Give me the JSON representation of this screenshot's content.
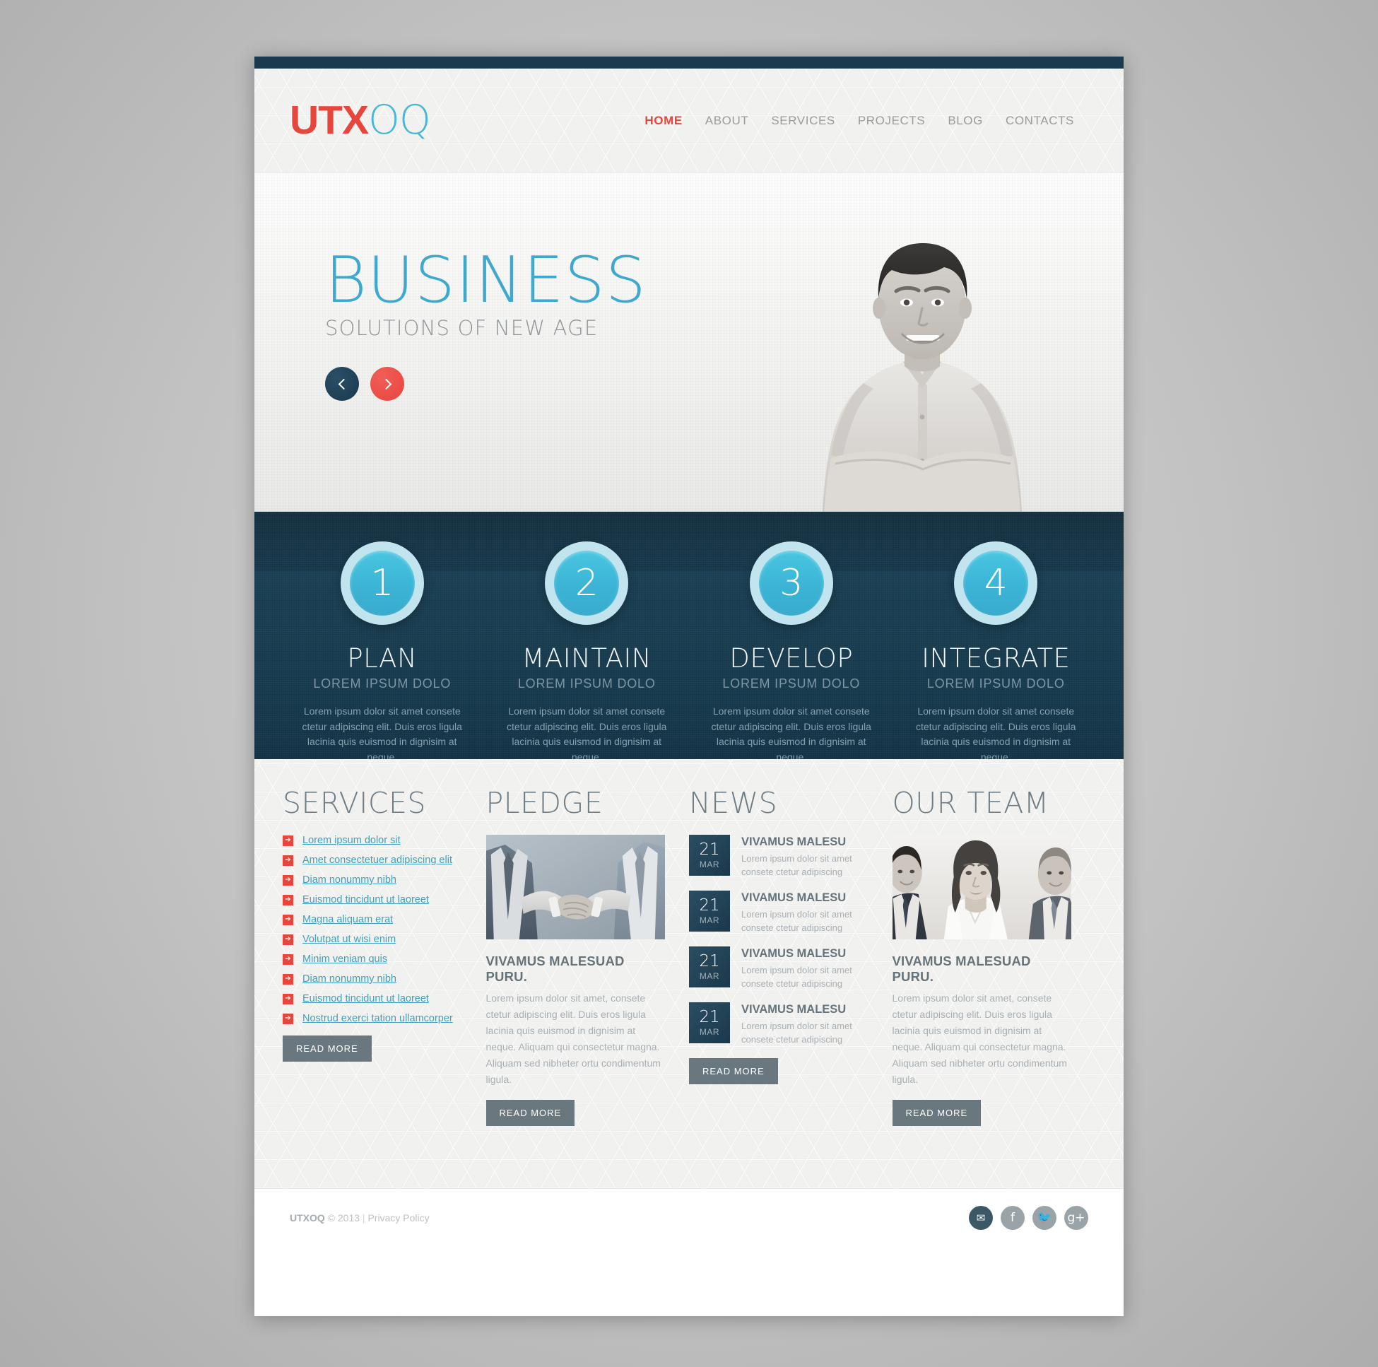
{
  "brand": {
    "logo_part1": "UTX",
    "logo_part2": "OQ",
    "accent_red": "#e8453c",
    "accent_cyan": "#4ab6d6",
    "dark_navy": "#1c3a4f"
  },
  "nav": {
    "items": [
      {
        "label": "HOME",
        "active": true
      },
      {
        "label": "ABOUT",
        "active": false
      },
      {
        "label": "SERVICES",
        "active": false
      },
      {
        "label": "PROJECTS",
        "active": false
      },
      {
        "label": "BLOG",
        "active": false
      },
      {
        "label": "CONTACTS",
        "active": false
      }
    ]
  },
  "hero": {
    "title": "BUSINESS",
    "subtitle": "SOLUTIONS OF NEW AGE",
    "prev_icon": "chevron-left",
    "next_icon": "chevron-right"
  },
  "features": [
    {
      "number": "1",
      "title": "PLAN",
      "subtitle": "LOREM IPSUM DOLO",
      "text": "Lorem ipsum dolor sit amet consete ctetur adipiscing elit. Duis eros ligula lacinia quis euismod in dignisim at neque."
    },
    {
      "number": "2",
      "title": "MAINTAIN",
      "subtitle": "LOREM IPSUM DOLO",
      "text": "Lorem ipsum dolor sit amet consete ctetur adipiscing elit. Duis eros ligula lacinia quis euismod in dignisim at neque."
    },
    {
      "number": "3",
      "title": "DEVELOP",
      "subtitle": "LOREM IPSUM DOLO",
      "text": "Lorem ipsum dolor sit amet consete ctetur adipiscing elit. Duis eros ligula lacinia quis euismod in dignisim at neque."
    },
    {
      "number": "4",
      "title": "INTEGRATE",
      "subtitle": "LOREM IPSUM DOLO",
      "text": "Lorem ipsum dolor sit amet consete ctetur adipiscing elit. Duis eros ligula lacinia quis euismod in dignisim at neque."
    }
  ],
  "services": {
    "title": "SERVICES",
    "items": [
      "Lorem ipsum dolor sit",
      "Amet consectetuer adipiscing elit",
      "Diam nonummy nibh",
      "Euismod tincidunt ut laoreet",
      "Magna aliquam erat",
      "Volutpat ut wisi enim",
      "Minim veniam quis",
      "Diam nonummy nibh",
      "Euismod tincidunt ut laoreet",
      "Nostrud exerci tation ullamcorper"
    ],
    "read_more": "READ MORE"
  },
  "pledge": {
    "title": "PLEDGE",
    "image_alt": "handshake-photo",
    "heading": "VIVAMUS MALESUAD PURU.",
    "text": "Lorem ipsum dolor sit amet, consete ctetur adipiscing elit. Duis eros ligula lacinia quis euismod in dignisim at neque. Aliquam qui consectetur magna. Aliquam sed nibheter ortu condimentum ligula.",
    "read_more": "READ MORE"
  },
  "news": {
    "title": "NEWS",
    "items": [
      {
        "day": "21",
        "month": "MAR",
        "title": "VIVAMUS MALESU",
        "text": "Lorem ipsum dolor sit amet consete ctetur adipiscing"
      },
      {
        "day": "21",
        "month": "MAR",
        "title": "VIVAMUS MALESU",
        "text": "Lorem ipsum dolor sit amet consete ctetur adipiscing"
      },
      {
        "day": "21",
        "month": "MAR",
        "title": "VIVAMUS MALESU",
        "text": "Lorem ipsum dolor sit amet consete ctetur adipiscing"
      },
      {
        "day": "21",
        "month": "MAR",
        "title": "VIVAMUS MALESU",
        "text": "Lorem ipsum dolor sit amet consete ctetur adipiscing"
      }
    ],
    "read_more": "READ MORE"
  },
  "team": {
    "title": "OUR TEAM",
    "image_alt": "team-photo",
    "heading": "VIVAMUS MALESUAD PURU.",
    "text": "Lorem ipsum dolor sit amet, consete ctetur adipiscing elit. Duis eros ligula lacinia quis euismod in dignisim at neque. Aliquam qui consectetur magna. Aliquam sed nibheter ortu condimentum ligula.",
    "read_more": "READ MORE"
  },
  "footer": {
    "copyright_brand": "UTXOQ",
    "copyright_text": "© 2013",
    "separator": "|",
    "privacy": "Privacy Policy",
    "social": [
      {
        "name": "email",
        "glyph": "✉"
      },
      {
        "name": "facebook",
        "glyph": "f"
      },
      {
        "name": "twitter",
        "glyph": "🐦"
      },
      {
        "name": "google-plus",
        "glyph": "g+"
      }
    ]
  }
}
